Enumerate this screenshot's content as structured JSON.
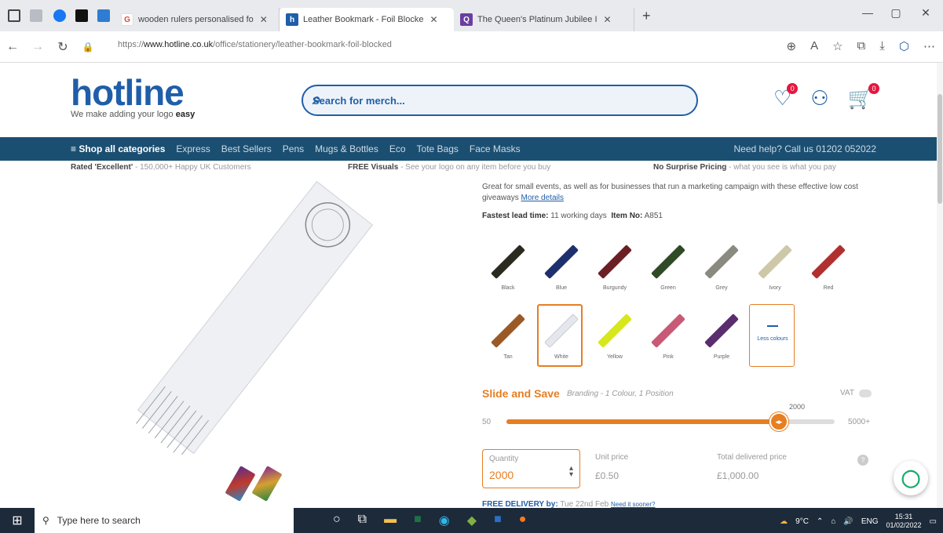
{
  "browser": {
    "tabs": [
      {
        "label": "wooden rulers personalised fo",
        "favicon_color": "#ea4335",
        "favicon": "G"
      },
      {
        "label": "Leather Bookmark - Foil Blocke",
        "favicon_color": "#1f5ea8",
        "favicon": "h"
      },
      {
        "label": "The Queen's Platinum Jubilee I",
        "favicon_color": "#6a3fa0",
        "favicon": "Q"
      }
    ],
    "new_tab": "+",
    "url_prefix": "https://",
    "url_domain": "www.hotline.co.uk",
    "url_path": "/office/stationery/leather-bookmark-foil-blocked"
  },
  "header": {
    "logo": "hotline",
    "tagline_prefix": "We make adding your logo ",
    "tagline_bold": "easy",
    "search_placeholder": "Search for merch...",
    "wishlist_count": "0",
    "cart_count": "0"
  },
  "nav": {
    "shop_all": "≡ Shop all categories",
    "items": [
      "Express",
      "Best Sellers",
      "Pens",
      "Mugs & Bottles",
      "Eco",
      "Tote Bags",
      "Face Masks"
    ],
    "help": "Need help? Call us 01202 052022"
  },
  "usp": {
    "rated_bold": "Rated 'Excellent'",
    "rated_rest": " - 150,000+ Happy UK Customers",
    "visuals_bold": "FREE Visuals",
    "visuals_rest": " - See your logo on any item before you buy",
    "pricing_bold": "No Surprise Pricing",
    "pricing_rest": " - what you see is what you pay"
  },
  "product": {
    "desc_text": "Great for small events, as well as for businesses that run a marketing campaign with these effective low cost giveaways",
    "more_details": "More details",
    "lead_label": "Fastest lead time:",
    "lead_value": "11 working days",
    "item_label": "Item No:",
    "item_value": "A851",
    "swatches": [
      {
        "label": "Black",
        "color": "#2a2a1e"
      },
      {
        "label": "Blue",
        "color": "#1e2f6e"
      },
      {
        "label": "Burgundy",
        "color": "#6b1f24"
      },
      {
        "label": "Green",
        "color": "#2f4a25"
      },
      {
        "label": "Grey",
        "color": "#8a8a80"
      },
      {
        "label": "Ivory",
        "color": "#cfc8a8"
      },
      {
        "label": "Red",
        "color": "#b03030"
      },
      {
        "label": "Tan",
        "color": "#9a5a28"
      },
      {
        "label": "White",
        "color": "#e4e8ee"
      },
      {
        "label": "Yellow",
        "color": "#d6e81c"
      },
      {
        "label": "Pink",
        "color": "#c85a78"
      },
      {
        "label": "Purple",
        "color": "#5a2d6e"
      }
    ],
    "less_colours": "Less colours",
    "selected_colour": "White"
  },
  "pricing": {
    "title": "Slide and Save",
    "subtitle": "Branding - 1 Colour, 1 Position",
    "vat": "VAT",
    "slider_min": "50",
    "slider_max": "5000+",
    "slider_value": "2000",
    "slider_fraction": 0.83,
    "quantity_label": "Quantity",
    "quantity_value": "2000",
    "unit_label": "Unit price",
    "unit_value": "£0.50",
    "total_label": "Total delivered price",
    "total_value": "£1,000.00",
    "delivery_bold": "FREE DELIVERY by:",
    "delivery_date": "Tue 22nd Feb",
    "delivery_link": "Need it sooner?"
  },
  "taskbar": {
    "search_placeholder": "Type here to search",
    "weather": "9°C",
    "lang": "ENG",
    "time": "15:31",
    "date": "01/02/2022"
  }
}
